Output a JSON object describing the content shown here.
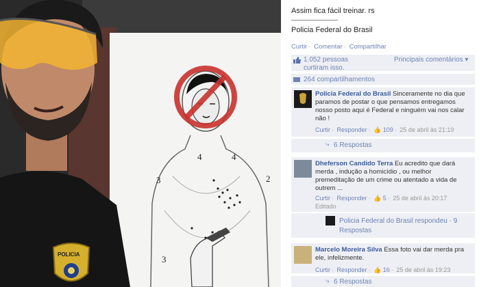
{
  "photo": {
    "target_numbers": [
      "4",
      "4",
      "3",
      "2",
      "3"
    ],
    "badge_text": "POLICIA"
  },
  "post": {
    "text": "Assim fica fácil treinar. rs",
    "page_link": "Policia Federal do Brasil",
    "actions": [
      "Curtir",
      "Comentar",
      "Compartilhar"
    ]
  },
  "likes": {
    "text": "1.052 pessoas curtiram isso.",
    "sort_label": "Principais comentários",
    "sort_arrow": "▾"
  },
  "shares": {
    "text": "264 compartilhamentos"
  },
  "comments": [
    {
      "author": "Policia Federal do Brasil",
      "text": "Sinceramente no dia que paramos de postar o que pensamos entregamos nosso posto aqui é Federal e ninguém vai nos calar não !",
      "like_label": "Curtir",
      "reply_label": "Responder",
      "likes": "109",
      "time": "25 de abril às 21:19",
      "replies_label": "6 Respostas"
    },
    {
      "author": "Dheferson Candido Terra",
      "text": "Eu acredito que dará merda , indução a homicídio , ou melhor premeditação de um crime ou atentado a vida de outrem ...",
      "like_label": "Curtir",
      "reply_label": "Responder",
      "likes": "5",
      "time": "25 de abril às 20:17",
      "edited": "Editado",
      "reply_summary": "Policia Federal do Brasil respondeu · 9 Respostas"
    },
    {
      "author": "Marcelo Moreira Silva",
      "text": "Essa foto vai dar merda pra ele, infelizmente.",
      "like_label": "Curtir",
      "reply_label": "Responder",
      "likes": "16",
      "time": "25 de abril às 19:23",
      "replies_label": "6 Respostas"
    }
  ],
  "colors": {
    "facebook_blue": "#3b5998",
    "link": "#6d84b4",
    "panel": "#edeff4",
    "forbidden_red": "#c8322d"
  },
  "icons": [
    "thumbs-up-icon",
    "share-icon",
    "reply-arrow-icon",
    "prohibited-sign-icon",
    "police-badge-icon"
  ]
}
